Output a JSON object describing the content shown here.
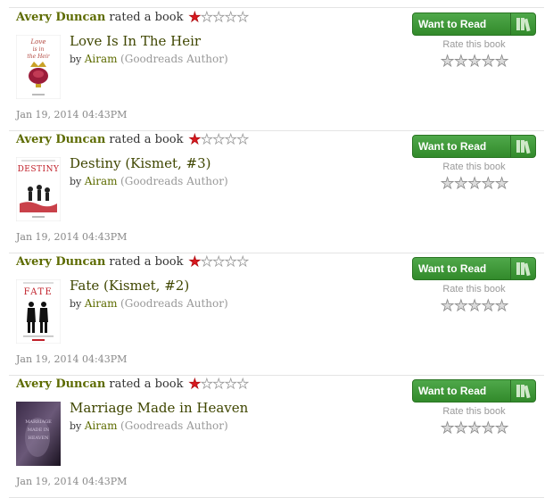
{
  "feed": [
    {
      "user": "Avery Duncan",
      "action": "rated a book",
      "rating": 1,
      "max_rating": 5,
      "book_title": "Love Is In The Heir",
      "by_label": "by",
      "author": "Airam",
      "author_tag": "(Goodreads Author)",
      "timestamp": "Jan 19, 2014 04:43PM",
      "want_to_read_label": "Want to Read",
      "rate_label": "Rate this book",
      "cover_text": [
        "Love",
        "is in",
        "the Heir"
      ],
      "cover_colors": {
        "bg": "#ffffff",
        "ink": "#b2483f"
      }
    },
    {
      "user": "Avery Duncan",
      "action": "rated a book",
      "rating": 1,
      "max_rating": 5,
      "book_title": "Destiny (Kismet, #3)",
      "by_label": "by",
      "author": "Airam",
      "author_tag": "(Goodreads Author)",
      "timestamp": "Jan 19, 2014 04:43PM",
      "want_to_read_label": "Want to Read",
      "rate_label": "Rate this book",
      "cover_text": [
        "DESTINY"
      ],
      "cover_colors": {
        "bg": "#ffffff",
        "ink": "#c0202a"
      }
    },
    {
      "user": "Avery Duncan",
      "action": "rated a book",
      "rating": 1,
      "max_rating": 5,
      "book_title": "Fate (Kismet, #2)",
      "by_label": "by",
      "author": "Airam",
      "author_tag": "(Goodreads Author)",
      "timestamp": "Jan 19, 2014 04:43PM",
      "want_to_read_label": "Want to Read",
      "rate_label": "Rate this book",
      "cover_text": [
        "FATE"
      ],
      "cover_colors": {
        "bg": "#ffffff",
        "ink": "#c0202a"
      }
    },
    {
      "user": "Avery Duncan",
      "action": "rated a book",
      "rating": 1,
      "max_rating": 5,
      "book_title": "Marriage Made in Heaven",
      "by_label": "by",
      "author": "Airam",
      "author_tag": "(Goodreads Author)",
      "timestamp": "Jan 19, 2014 04:43PM",
      "want_to_read_label": "Want to Read",
      "rate_label": "Rate this book",
      "cover_text": [
        "MARRIAGE",
        "MADE IN",
        "HEAVEN"
      ],
      "cover_colors": {
        "bg": "#2a1d33",
        "ink": "#d6c9e0"
      }
    }
  ],
  "colors": {
    "user_link": "#5d6b00",
    "title_link": "#3f4600",
    "star_filled": "#d9181f",
    "button_green": "#409a3a",
    "muted": "#999999"
  },
  "icons": {
    "rating_star": "star-icon",
    "shelf": "bookshelf-icon"
  }
}
